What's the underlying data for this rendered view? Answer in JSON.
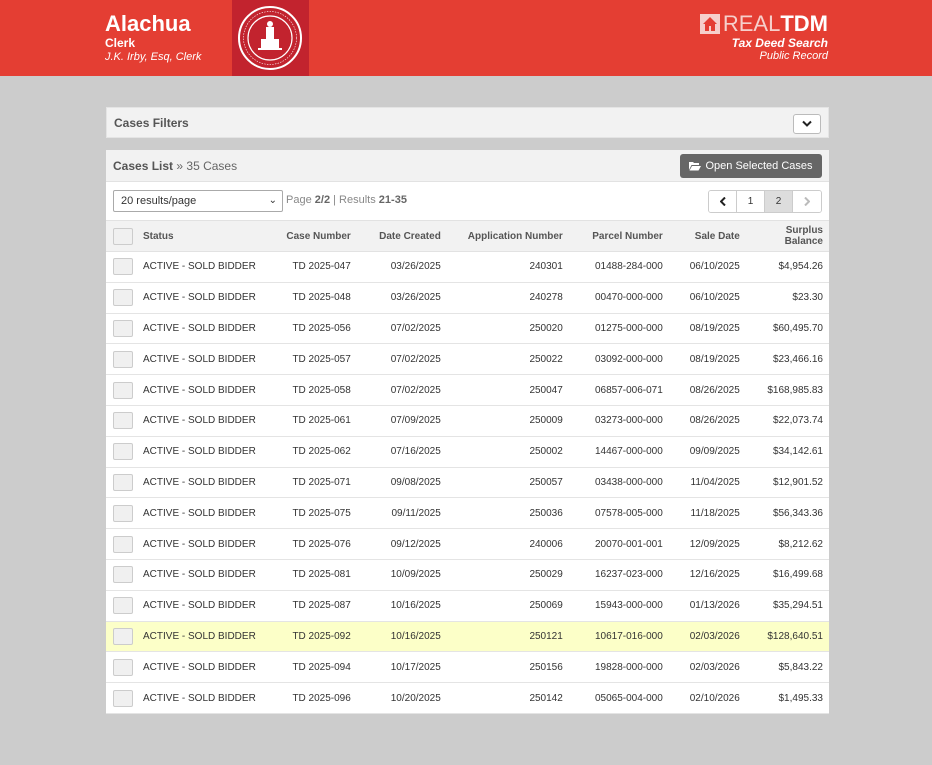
{
  "header": {
    "county_name": "Alachua",
    "role": "Clerk",
    "clerk_name": "J.K. Irby, Esq, Clerk",
    "seal_icon": "county-seal-icon",
    "brand_light": "REAL",
    "brand_bold": "TDM",
    "brand_subtitle": "Tax Deed Search",
    "brand_tagline": "Public Record",
    "colors": {
      "header_bg": "#e43e33",
      "seal_bg": "#c2232e"
    }
  },
  "filters": {
    "title": "Cases Filters",
    "toggle_icon": "chevron-down-icon"
  },
  "cases": {
    "title": "Cases List",
    "separator": "»",
    "count_text": "35 Cases",
    "open_button": "Open Selected Cases",
    "open_icon": "folder-open-icon"
  },
  "toolbar": {
    "per_page": "20 results/page",
    "page_label": "Page",
    "page_value": "2/2",
    "divider": "|",
    "results_label": "Results",
    "results_value": "21-35",
    "pager": {
      "prev": "‹",
      "pages": [
        "1",
        "2"
      ],
      "active_page": "2",
      "next": "›"
    }
  },
  "table": {
    "columns": [
      "Status",
      "Case Number",
      "Date Created",
      "Application Number",
      "Parcel Number",
      "Sale Date",
      "Surplus Balance"
    ],
    "rows": [
      {
        "status": "ACTIVE - SOLD BIDDER",
        "case": "TD 2025-047",
        "created": "03/26/2025",
        "app": "240301",
        "parcel": "01488-284-000",
        "sale": "06/10/2025",
        "surplus": "$4,954.26"
      },
      {
        "status": "ACTIVE - SOLD BIDDER",
        "case": "TD 2025-048",
        "created": "03/26/2025",
        "app": "240278",
        "parcel": "00470-000-000",
        "sale": "06/10/2025",
        "surplus": "$23.30"
      },
      {
        "status": "ACTIVE - SOLD BIDDER",
        "case": "TD 2025-056",
        "created": "07/02/2025",
        "app": "250020",
        "parcel": "01275-000-000",
        "sale": "08/19/2025",
        "surplus": "$60,495.70"
      },
      {
        "status": "ACTIVE - SOLD BIDDER",
        "case": "TD 2025-057",
        "created": "07/02/2025",
        "app": "250022",
        "parcel": "03092-000-000",
        "sale": "08/19/2025",
        "surplus": "$23,466.16"
      },
      {
        "status": "ACTIVE - SOLD BIDDER",
        "case": "TD 2025-058",
        "created": "07/02/2025",
        "app": "250047",
        "parcel": "06857-006-071",
        "sale": "08/26/2025",
        "surplus": "$168,985.83"
      },
      {
        "status": "ACTIVE - SOLD BIDDER",
        "case": "TD 2025-061",
        "created": "07/09/2025",
        "app": "250009",
        "parcel": "03273-000-000",
        "sale": "08/26/2025",
        "surplus": "$22,073.74"
      },
      {
        "status": "ACTIVE - SOLD BIDDER",
        "case": "TD 2025-062",
        "created": "07/16/2025",
        "app": "250002",
        "parcel": "14467-000-000",
        "sale": "09/09/2025",
        "surplus": "$34,142.61"
      },
      {
        "status": "ACTIVE - SOLD BIDDER",
        "case": "TD 2025-071",
        "created": "09/08/2025",
        "app": "250057",
        "parcel": "03438-000-000",
        "sale": "11/04/2025",
        "surplus": "$12,901.52"
      },
      {
        "status": "ACTIVE - SOLD BIDDER",
        "case": "TD 2025-075",
        "created": "09/11/2025",
        "app": "250036",
        "parcel": "07578-005-000",
        "sale": "11/18/2025",
        "surplus": "$56,343.36"
      },
      {
        "status": "ACTIVE - SOLD BIDDER",
        "case": "TD 2025-076",
        "created": "09/12/2025",
        "app": "240006",
        "parcel": "20070-001-001",
        "sale": "12/09/2025",
        "surplus": "$8,212.62"
      },
      {
        "status": "ACTIVE - SOLD BIDDER",
        "case": "TD 2025-081",
        "created": "10/09/2025",
        "app": "250029",
        "parcel": "16237-023-000",
        "sale": "12/16/2025",
        "surplus": "$16,499.68"
      },
      {
        "status": "ACTIVE - SOLD BIDDER",
        "case": "TD 2025-087",
        "created": "10/16/2025",
        "app": "250069",
        "parcel": "15943-000-000",
        "sale": "01/13/2026",
        "surplus": "$35,294.51"
      },
      {
        "status": "ACTIVE - SOLD BIDDER",
        "case": "TD 2025-092",
        "created": "10/16/2025",
        "app": "250121",
        "parcel": "10617-016-000",
        "sale": "02/03/2026",
        "surplus": "$128,640.51",
        "highlighted": true
      },
      {
        "status": "ACTIVE - SOLD BIDDER",
        "case": "TD 2025-094",
        "created": "10/17/2025",
        "app": "250156",
        "parcel": "19828-000-000",
        "sale": "02/03/2026",
        "surplus": "$5,843.22"
      },
      {
        "status": "ACTIVE - SOLD BIDDER",
        "case": "TD 2025-096",
        "created": "10/20/2025",
        "app": "250142",
        "parcel": "05065-004-000",
        "sale": "02/10/2026",
        "surplus": "$1,495.33"
      }
    ]
  }
}
